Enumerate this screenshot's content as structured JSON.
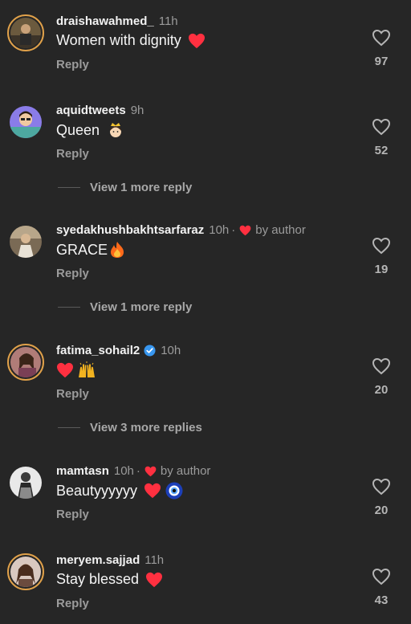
{
  "comments": [
    {
      "username": "draishawahmed_",
      "time": "11h",
      "text": "Women with dignity",
      "emoji": "heart-emoji",
      "reply": "Reply",
      "likes": "97",
      "verified": false,
      "by_author": ""
    },
    {
      "username": "aquidtweets",
      "time": "9h",
      "text": "Queen",
      "emoji": "princess-emoji",
      "reply": "Reply",
      "likes": "52",
      "verified": false,
      "by_author": "",
      "view_more": "View 1 more reply"
    },
    {
      "username": "syedakhushbakhtsarfaraz",
      "time": "10h",
      "text": "GRACE",
      "emoji": "fire-emoji",
      "reply": "Reply",
      "likes": "19",
      "verified": false,
      "by_author": "by author",
      "view_more": "View 1 more reply"
    },
    {
      "username": "fatima_sohail2",
      "time": "10h",
      "text": "",
      "emoji": "heart-and-raised-hands-emoji",
      "reply": "Reply",
      "likes": "20",
      "verified": true,
      "by_author": "",
      "view_more": "View 3 more replies"
    },
    {
      "username": "mamtasn",
      "time": "10h",
      "text": "Beautyyyyyy",
      "emoji": "heart-and-nazar-emoji",
      "reply": "Reply",
      "likes": "20",
      "verified": false,
      "by_author": "by author"
    },
    {
      "username": "meryem.sajjad",
      "time": "11h",
      "text": "Stay blessed",
      "emoji": "heart-emoji",
      "reply": "Reply",
      "likes": "43",
      "verified": false,
      "by_author": ""
    }
  ],
  "colors": {
    "background": "#262626",
    "heart": "#ff3040",
    "verified": "#3897f0",
    "muted": "#9b9b9b"
  }
}
